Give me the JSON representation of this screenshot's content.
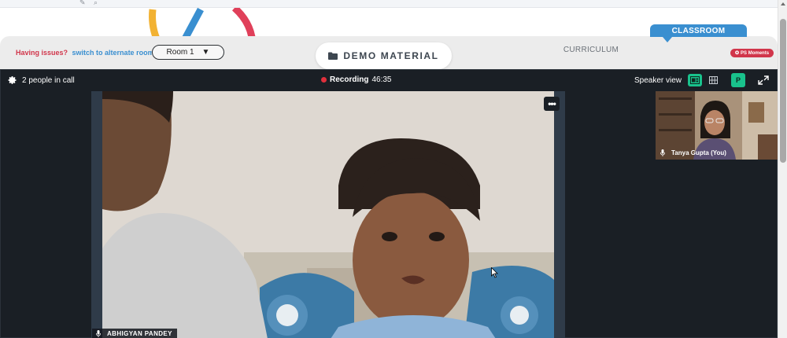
{
  "issues": {
    "prompt": "Having issues?",
    "link": "switch to alternate room"
  },
  "room_select": {
    "value": "Room 1"
  },
  "tabs": {
    "demo_material": "DEMO MATERIAL",
    "curriculum": "CURRICULUM",
    "classroom": "CLASSROOM",
    "ps_moments": "PS Moments"
  },
  "call": {
    "people_count": "2 people in call",
    "recording_label": "Recording",
    "recording_time": "46:35",
    "view_mode": "Speaker view",
    "avatar_initial": "P"
  },
  "participants": {
    "main_name": "ABHIGYAN PANDEY",
    "self_name": "Tanya Gupta (You)"
  },
  "colors": {
    "accent_green": "#19c28c",
    "classroom_blue": "#3a8fd0",
    "alert_red": "#d1364b",
    "recording_red": "#e0303c",
    "call_bg": "#1a1f25"
  }
}
